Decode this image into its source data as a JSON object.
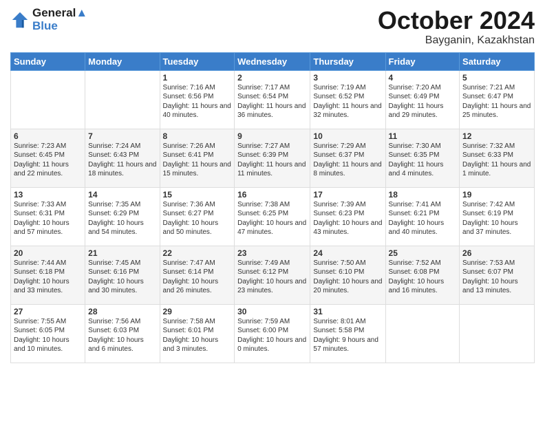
{
  "header": {
    "logo_line1": "General",
    "logo_line2": "Blue",
    "month_title": "October 2024",
    "location": "Bayganin, Kazakhstan"
  },
  "days_of_week": [
    "Sunday",
    "Monday",
    "Tuesday",
    "Wednesday",
    "Thursday",
    "Friday",
    "Saturday"
  ],
  "weeks": [
    [
      {
        "day": "",
        "sunrise": "",
        "sunset": "",
        "daylight": ""
      },
      {
        "day": "",
        "sunrise": "",
        "sunset": "",
        "daylight": ""
      },
      {
        "day": "1",
        "sunrise": "Sunrise: 7:16 AM",
        "sunset": "Sunset: 6:56 PM",
        "daylight": "Daylight: 11 hours and 40 minutes."
      },
      {
        "day": "2",
        "sunrise": "Sunrise: 7:17 AM",
        "sunset": "Sunset: 6:54 PM",
        "daylight": "Daylight: 11 hours and 36 minutes."
      },
      {
        "day": "3",
        "sunrise": "Sunrise: 7:19 AM",
        "sunset": "Sunset: 6:52 PM",
        "daylight": "Daylight: 11 hours and 32 minutes."
      },
      {
        "day": "4",
        "sunrise": "Sunrise: 7:20 AM",
        "sunset": "Sunset: 6:49 PM",
        "daylight": "Daylight: 11 hours and 29 minutes."
      },
      {
        "day": "5",
        "sunrise": "Sunrise: 7:21 AM",
        "sunset": "Sunset: 6:47 PM",
        "daylight": "Daylight: 11 hours and 25 minutes."
      }
    ],
    [
      {
        "day": "6",
        "sunrise": "Sunrise: 7:23 AM",
        "sunset": "Sunset: 6:45 PM",
        "daylight": "Daylight: 11 hours and 22 minutes."
      },
      {
        "day": "7",
        "sunrise": "Sunrise: 7:24 AM",
        "sunset": "Sunset: 6:43 PM",
        "daylight": "Daylight: 11 hours and 18 minutes."
      },
      {
        "day": "8",
        "sunrise": "Sunrise: 7:26 AM",
        "sunset": "Sunset: 6:41 PM",
        "daylight": "Daylight: 11 hours and 15 minutes."
      },
      {
        "day": "9",
        "sunrise": "Sunrise: 7:27 AM",
        "sunset": "Sunset: 6:39 PM",
        "daylight": "Daylight: 11 hours and 11 minutes."
      },
      {
        "day": "10",
        "sunrise": "Sunrise: 7:29 AM",
        "sunset": "Sunset: 6:37 PM",
        "daylight": "Daylight: 11 hours and 8 minutes."
      },
      {
        "day": "11",
        "sunrise": "Sunrise: 7:30 AM",
        "sunset": "Sunset: 6:35 PM",
        "daylight": "Daylight: 11 hours and 4 minutes."
      },
      {
        "day": "12",
        "sunrise": "Sunrise: 7:32 AM",
        "sunset": "Sunset: 6:33 PM",
        "daylight": "Daylight: 11 hours and 1 minute."
      }
    ],
    [
      {
        "day": "13",
        "sunrise": "Sunrise: 7:33 AM",
        "sunset": "Sunset: 6:31 PM",
        "daylight": "Daylight: 10 hours and 57 minutes."
      },
      {
        "day": "14",
        "sunrise": "Sunrise: 7:35 AM",
        "sunset": "Sunset: 6:29 PM",
        "daylight": "Daylight: 10 hours and 54 minutes."
      },
      {
        "day": "15",
        "sunrise": "Sunrise: 7:36 AM",
        "sunset": "Sunset: 6:27 PM",
        "daylight": "Daylight: 10 hours and 50 minutes."
      },
      {
        "day": "16",
        "sunrise": "Sunrise: 7:38 AM",
        "sunset": "Sunset: 6:25 PM",
        "daylight": "Daylight: 10 hours and 47 minutes."
      },
      {
        "day": "17",
        "sunrise": "Sunrise: 7:39 AM",
        "sunset": "Sunset: 6:23 PM",
        "daylight": "Daylight: 10 hours and 43 minutes."
      },
      {
        "day": "18",
        "sunrise": "Sunrise: 7:41 AM",
        "sunset": "Sunset: 6:21 PM",
        "daylight": "Daylight: 10 hours and 40 minutes."
      },
      {
        "day": "19",
        "sunrise": "Sunrise: 7:42 AM",
        "sunset": "Sunset: 6:19 PM",
        "daylight": "Daylight: 10 hours and 37 minutes."
      }
    ],
    [
      {
        "day": "20",
        "sunrise": "Sunrise: 7:44 AM",
        "sunset": "Sunset: 6:18 PM",
        "daylight": "Daylight: 10 hours and 33 minutes."
      },
      {
        "day": "21",
        "sunrise": "Sunrise: 7:45 AM",
        "sunset": "Sunset: 6:16 PM",
        "daylight": "Daylight: 10 hours and 30 minutes."
      },
      {
        "day": "22",
        "sunrise": "Sunrise: 7:47 AM",
        "sunset": "Sunset: 6:14 PM",
        "daylight": "Daylight: 10 hours and 26 minutes."
      },
      {
        "day": "23",
        "sunrise": "Sunrise: 7:49 AM",
        "sunset": "Sunset: 6:12 PM",
        "daylight": "Daylight: 10 hours and 23 minutes."
      },
      {
        "day": "24",
        "sunrise": "Sunrise: 7:50 AM",
        "sunset": "Sunset: 6:10 PM",
        "daylight": "Daylight: 10 hours and 20 minutes."
      },
      {
        "day": "25",
        "sunrise": "Sunrise: 7:52 AM",
        "sunset": "Sunset: 6:08 PM",
        "daylight": "Daylight: 10 hours and 16 minutes."
      },
      {
        "day": "26",
        "sunrise": "Sunrise: 7:53 AM",
        "sunset": "Sunset: 6:07 PM",
        "daylight": "Daylight: 10 hours and 13 minutes."
      }
    ],
    [
      {
        "day": "27",
        "sunrise": "Sunrise: 7:55 AM",
        "sunset": "Sunset: 6:05 PM",
        "daylight": "Daylight: 10 hours and 10 minutes."
      },
      {
        "day": "28",
        "sunrise": "Sunrise: 7:56 AM",
        "sunset": "Sunset: 6:03 PM",
        "daylight": "Daylight: 10 hours and 6 minutes."
      },
      {
        "day": "29",
        "sunrise": "Sunrise: 7:58 AM",
        "sunset": "Sunset: 6:01 PM",
        "daylight": "Daylight: 10 hours and 3 minutes."
      },
      {
        "day": "30",
        "sunrise": "Sunrise: 7:59 AM",
        "sunset": "Sunset: 6:00 PM",
        "daylight": "Daylight: 10 hours and 0 minutes."
      },
      {
        "day": "31",
        "sunrise": "Sunrise: 8:01 AM",
        "sunset": "Sunset: 5:58 PM",
        "daylight": "Daylight: 9 hours and 57 minutes."
      },
      {
        "day": "",
        "sunrise": "",
        "sunset": "",
        "daylight": ""
      },
      {
        "day": "",
        "sunrise": "",
        "sunset": "",
        "daylight": ""
      }
    ]
  ]
}
